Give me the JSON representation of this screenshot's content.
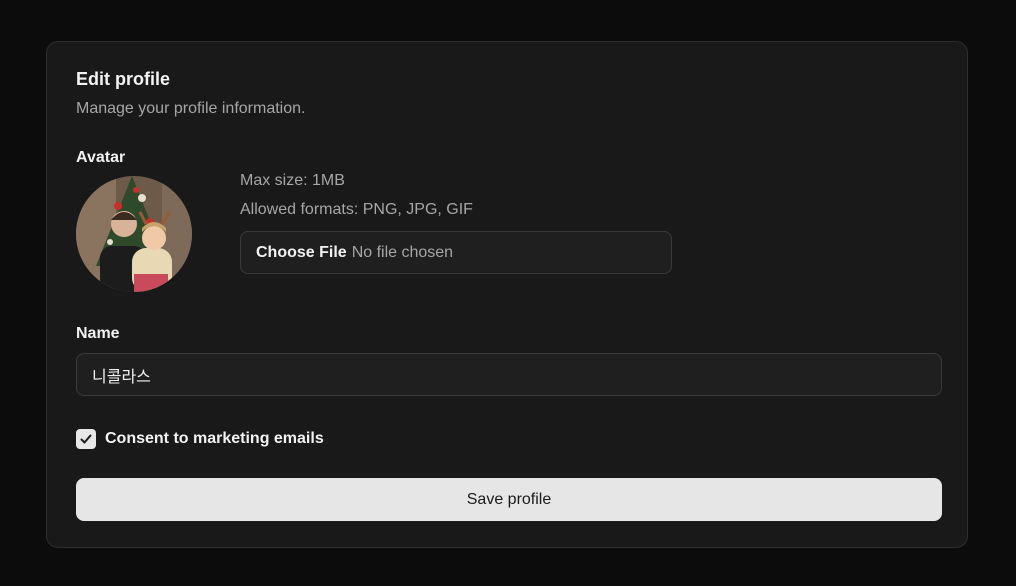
{
  "profile": {
    "title": "Edit profile",
    "subtitle": "Manage your profile information."
  },
  "avatar": {
    "label": "Avatar",
    "max_size": "Max size: 1MB",
    "allowed_formats": "Allowed formats: PNG, JPG, GIF",
    "choose_file_label": "Choose File",
    "file_status": "No file chosen"
  },
  "name": {
    "label": "Name",
    "value": "니콜라스"
  },
  "consent": {
    "label": "Consent to marketing emails",
    "checked": true
  },
  "actions": {
    "save_label": "Save profile"
  },
  "colors": {
    "background": "#0c0c0c",
    "card": "#191919",
    "primary_button": "#e6e6e6"
  }
}
